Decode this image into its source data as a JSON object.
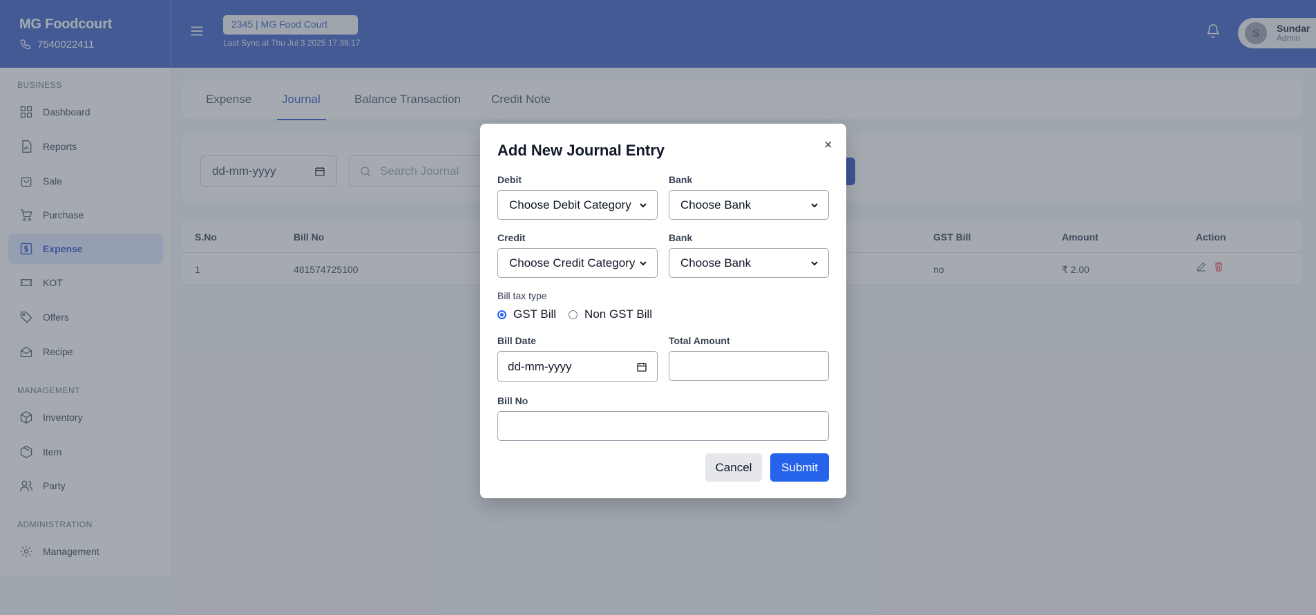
{
  "header": {
    "brand_name": "MG Foodcourt",
    "phone": "7540022411",
    "store": "2345 | MG Food Court",
    "last_sync": "Last Sync at Thu Jul 3 2025 17:36:17",
    "user_initial": "S",
    "user_name": "Sundar",
    "user_role": "Admin"
  },
  "sidebar": {
    "sections": [
      "BUSINESS",
      "MANAGEMENT",
      "ADMINISTRATION"
    ],
    "items": [
      {
        "label": "Dashboard",
        "icon": "grid-icon"
      },
      {
        "label": "Reports",
        "icon": "report-icon"
      },
      {
        "label": "Sale",
        "icon": "bag-icon"
      },
      {
        "label": "Purchase",
        "icon": "cart-icon"
      },
      {
        "label": "Expense",
        "icon": "dollar-icon",
        "active": true
      },
      {
        "label": "KOT",
        "icon": "ticket-icon"
      },
      {
        "label": "Offers",
        "icon": "tag-icon"
      },
      {
        "label": "Recipe",
        "icon": "recipe-icon"
      },
      {
        "label": "Inventory",
        "icon": "box-icon"
      },
      {
        "label": "Item",
        "icon": "cube-icon"
      },
      {
        "label": "Party",
        "icon": "users-icon"
      },
      {
        "label": "Management",
        "icon": "gear-icon"
      }
    ]
  },
  "tabs": [
    "Expense",
    "Journal",
    "Balance Transaction",
    "Credit Note"
  ],
  "active_tab": "Journal",
  "filters": {
    "date_placeholder": "dd-mm-yyyy",
    "search_placeholder": "Search Journal"
  },
  "table": {
    "headers": [
      "S.No",
      "Bill No",
      "GST Bill",
      "Amount",
      "Action"
    ],
    "rows": [
      {
        "sno": "1",
        "bill_no": "481574725100",
        "gst_bill": "no",
        "amount": "₹ 2.00"
      }
    ]
  },
  "modal": {
    "title": "Add New Journal Entry",
    "close": "×",
    "debit_label": "Debit",
    "debit_value": "Choose Debit Category",
    "bank_label": "Bank",
    "bank_value": "Choose Bank",
    "credit_label": "Credit",
    "credit_value": "Choose Credit Category",
    "bank2_label": "Bank",
    "bank2_value": "Choose Bank",
    "tax_type_label": "Bill tax type",
    "gst_option": "GST Bill",
    "non_gst_option": "Non GST Bill",
    "selected_tax_type": "GST Bill",
    "bill_date_label": "Bill Date",
    "bill_date_value": "dd-mm-yyyy",
    "total_amount_label": "Total Amount",
    "total_amount_value": "",
    "bill_no_label": "Bill No",
    "bill_no_value": "",
    "cancel": "Cancel",
    "submit": "Submit"
  },
  "colors": {
    "header_bg": "#3b5fc4",
    "accent": "#2563eb",
    "active_nav_bg": "#e0e7ff",
    "delete_icon": "#ef4444"
  }
}
